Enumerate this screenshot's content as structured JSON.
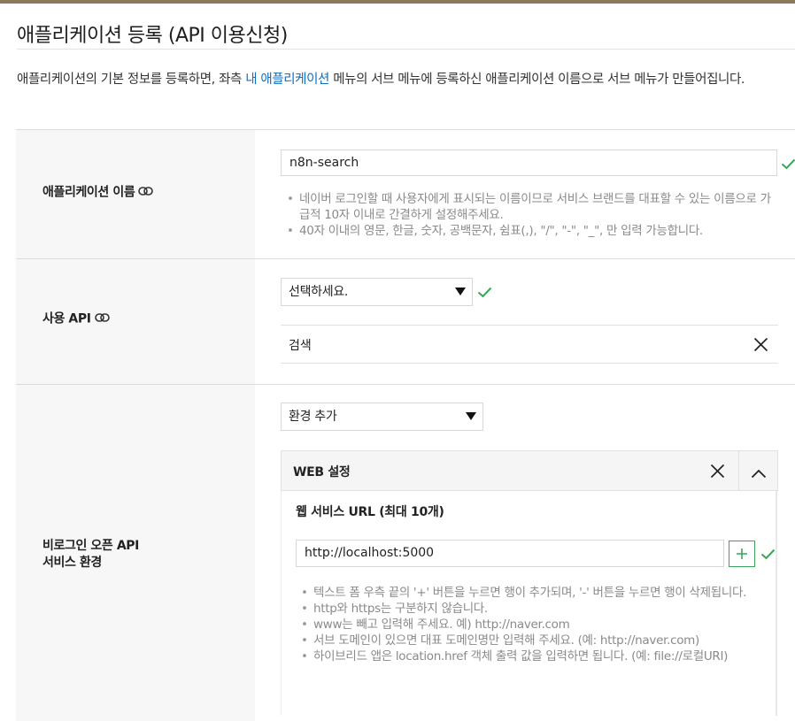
{
  "page": {
    "title": "애플리케이션 등록 (API 이용신청)",
    "description_before": "애플리케이션의 기본 정보를 등록하면, 좌측 ",
    "description_link": "내 애플리케이션",
    "description_after": " 메뉴의 서브 메뉴에 등록하신 애플리케이션 이름으로 서브 메뉴가 만들어집니다."
  },
  "colors": {
    "accent_top": "#8c7a5b",
    "check_green": "#3aa55a",
    "link_blue": "#0e6fc4"
  },
  "app_name": {
    "label": "애플리케이션 이름",
    "value": "n8n-search",
    "hints": [
      "네이버 로그인할 때 사용자에게 표시되는 이름이므로 서비스 브랜드를 대표할 수 있는 이름으로 가급적 10자 이내로 간결하게 설정해주세요.",
      "40자 이내의 영문, 한글, 숫자, 공백문자, 쉼표(,), \"/\", \"-\", \"_\", 만 입력 가능합니다."
    ]
  },
  "api": {
    "label": "사용 API",
    "select_value": "선택하세요.",
    "selected_items": [
      {
        "label": "검색"
      }
    ]
  },
  "environment": {
    "label_line1": "비로그인 오픈 API",
    "label_line2": "서비스 환경",
    "select_value": "환경 추가",
    "web": {
      "title": "WEB 설정",
      "url_heading": "웹 서비스 URL (최대 10개)",
      "url_value": "http://localhost:5000",
      "hints": [
        "텍스트 폼 우측 끝의 '+' 버튼을 누르면 행이 추가되며, '-' 버튼을 누르면 행이 삭제됩니다.",
        "http와 https는 구분하지 않습니다.",
        "www는 빼고 입력해 주세요. 예) http://naver.com",
        "서브 도메인이 있으면 대표 도메인명만 입력해 주세요. (예: http://naver.com)",
        "하이브리드 앱은 location.href 객체 출력 값을 입력하면 됩니다. (예: file://로컬URI)"
      ]
    }
  }
}
